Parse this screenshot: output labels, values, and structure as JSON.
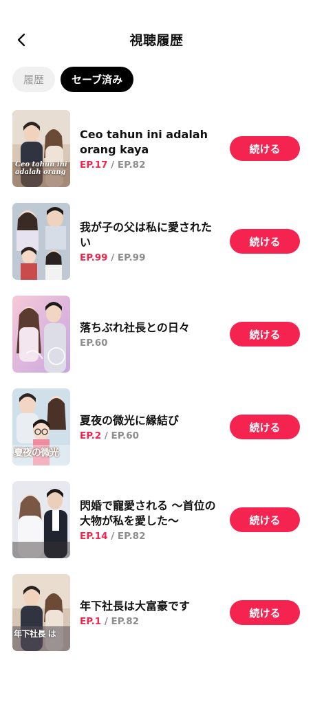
{
  "header": {
    "title": "視聴履歴",
    "back_icon": "chevron-left-icon"
  },
  "tabs": [
    {
      "label": "履歴",
      "active": false
    },
    {
      "label": "セーブ済み",
      "active": true
    }
  ],
  "colors": {
    "accent": "#f5234f",
    "episode_current": "#f0264f",
    "episode_total": "#8d8d8d"
  },
  "items": [
    {
      "title": "Ceo tahun ini adalah orang kaya",
      "ep_current": "EP.17",
      "ep_sep": " / ",
      "ep_total": "EP.82",
      "button": "続ける",
      "poster_text": "Ceo tahun ini adalah orang"
    },
    {
      "title": "我が子の父は私に愛されたい",
      "ep_current": "EP.99",
      "ep_sep": " / ",
      "ep_total": "EP.99",
      "button": "続ける"
    },
    {
      "title": "落ちぶれ社長との日々",
      "ep_current": "",
      "ep_sep": "",
      "ep_total": "EP.60",
      "button": "続ける"
    },
    {
      "title": "夏夜の微光に縁結び",
      "ep_current": "EP.2",
      "ep_sep": " / ",
      "ep_total": "EP.60",
      "button": "続ける",
      "poster_text": "夏夜の微光"
    },
    {
      "title": "閃婚で寵愛される ～首位の大物が私を愛した～",
      "ep_current": "EP.14",
      "ep_sep": " / ",
      "ep_total": "EP.82",
      "button": "続ける"
    },
    {
      "title": "年下社長は大富豪です",
      "ep_current": "EP.1",
      "ep_sep": " / ",
      "ep_total": "EP.82",
      "button": "続ける",
      "poster_text": "年下社長 は"
    }
  ]
}
